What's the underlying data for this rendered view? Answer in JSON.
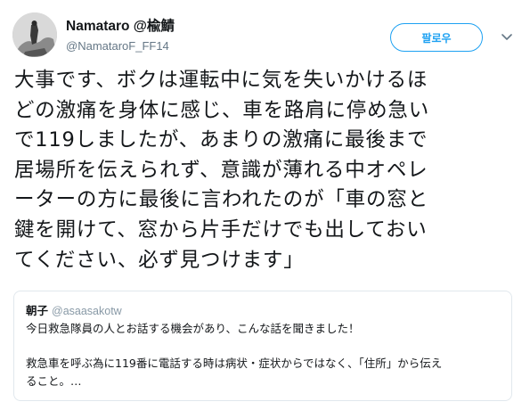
{
  "tweet": {
    "author": {
      "display_name": "Namataro @楡鯖",
      "handle": "@NamataroF_FF14",
      "avatar_icon": "avatar-icon"
    },
    "follow_label": "팔로우",
    "caret_icon": "chevron-down-icon",
    "text_lines": [
      "大事です、ボクは運転中に気を失いかけるほ",
      "どの激痛を身体に感じ、車を路肩に停め急い",
      "で119しましたが、あまりの激痛に最後まで",
      "居場所を伝えられず、意識が薄れる中オペレ",
      "ーターの方に最後に言われたのが「車の窓と",
      "鍵を開けて、窓から片手だけでも出しておい",
      "てください、必ず見つけます」"
    ]
  },
  "quoted": {
    "name": "朝子",
    "handle": "@asaasakotw",
    "lines": [
      "今日救急隊員の人とお話する機会があり、こんな話を聞きました！",
      "",
      "救急車を呼ぶ為に119番に電話する時は病状・症状からではなく、「住所」から伝え",
      "ること。…"
    ]
  },
  "colors": {
    "accent": "#1da1f2",
    "text": "#14171a",
    "muted": "#657786",
    "border": "#e1e8ed"
  }
}
